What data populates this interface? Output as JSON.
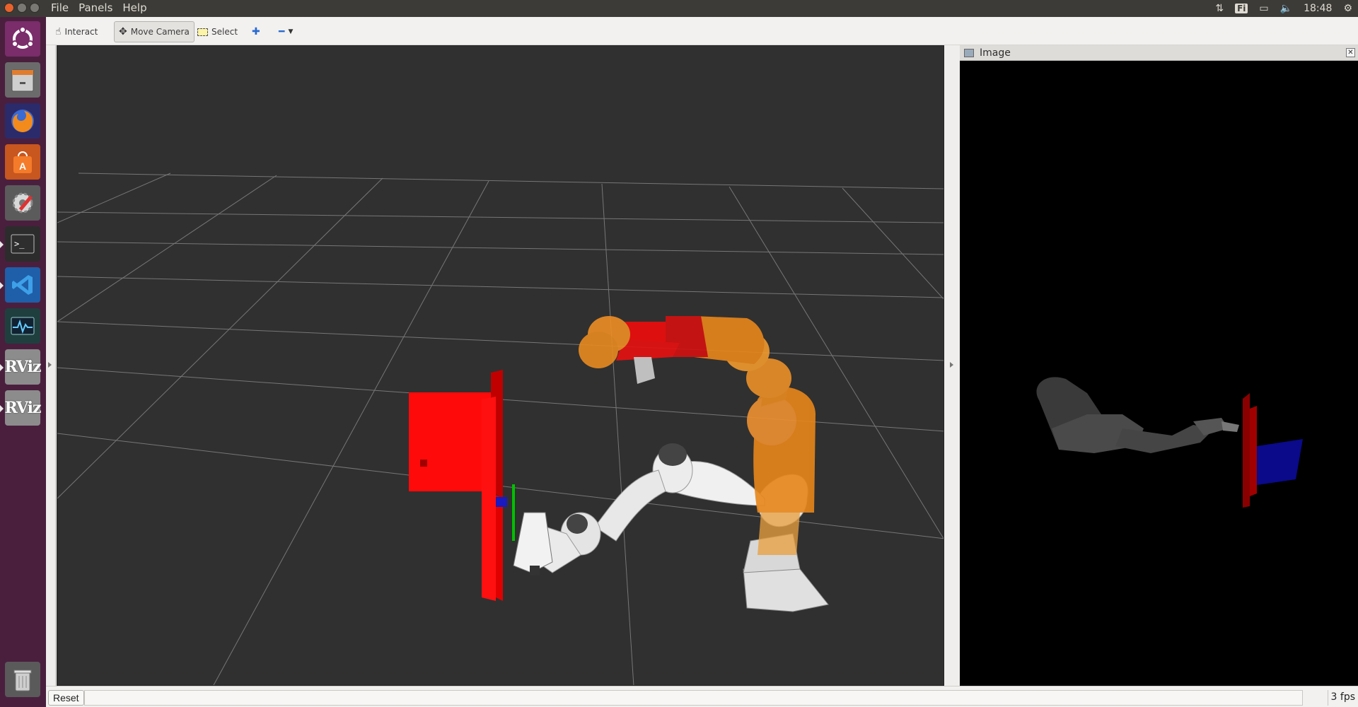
{
  "menubar": {
    "file": "File",
    "panels": "Panels",
    "help": "Help"
  },
  "indicators": {
    "keyboard": "Fi",
    "clock": "18:48"
  },
  "launcher": {
    "items": [
      "ubuntu-dash",
      "files",
      "firefox",
      "software-center",
      "system-settings",
      "terminal",
      "vscode",
      "system-monitor",
      "rviz",
      "rviz"
    ],
    "rviz_label": "RViz"
  },
  "toolbar": {
    "interact": "Interact",
    "move_camera": "Move Camera",
    "select": "Select"
  },
  "image_panel": {
    "title": "Image"
  },
  "statusbar": {
    "reset": "Reset",
    "fps": "3 fps"
  },
  "colors": {
    "launcher_bg": "#4a1f3e",
    "viewport_bg": "#303030",
    "grid": "#8a8a8a",
    "robot_orange": "#e8861a",
    "robot_red": "#e01010",
    "robot_white": "#e8e8e8",
    "shelf_red": "#ff0000",
    "box_blue": "#0a0a8a"
  }
}
